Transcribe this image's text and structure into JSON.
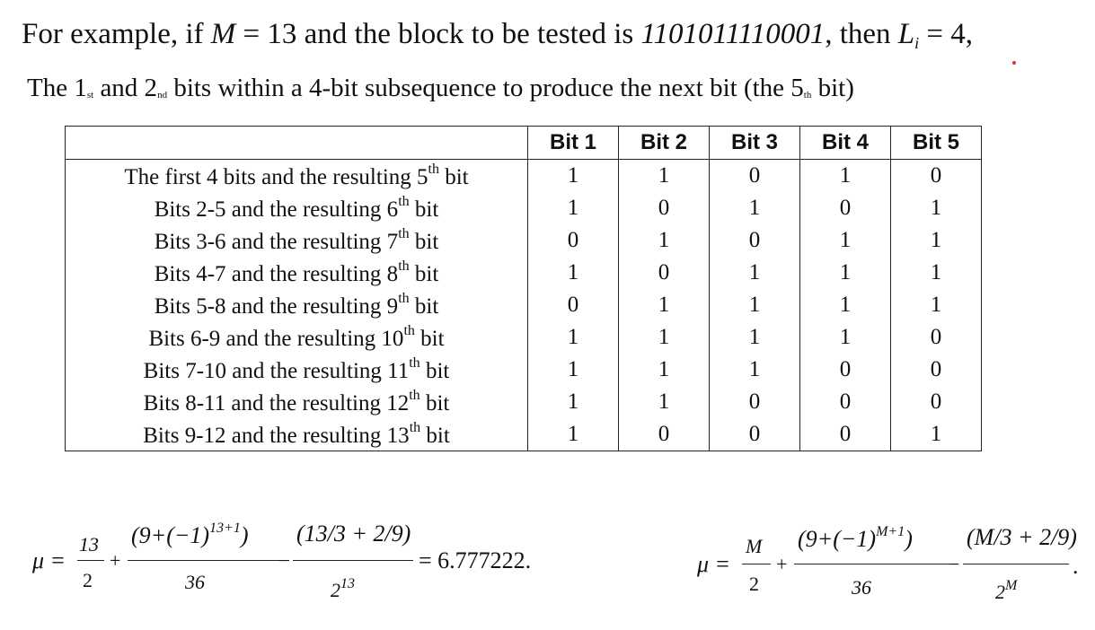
{
  "intro": {
    "prefix": "For example, if ",
    "var_M": "M",
    "eq_M": " = 13",
    "mid": " and the block to be tested is ",
    "block": "1101011110001",
    "then": ", then ",
    "var_L": "L",
    "sub_i": "i",
    "eq_L": " = 4,"
  },
  "line2": {
    "a": "The 1",
    "sup1": "st",
    "b": " and 2",
    "sup2": "nd",
    "c": " bits within a 4-bit subsequence to produce the next bit (the 5",
    "sup3": "th",
    "d": " bit)"
  },
  "table": {
    "headers": [
      "Bit 1",
      "Bit 2",
      "Bit 3",
      "Bit 4",
      "Bit 5"
    ],
    "rows": [
      {
        "label": "The first 4 bits and the resulting 5",
        "sup": "th",
        "tail": " bit",
        "bits": [
          "1",
          "1",
          "0",
          "1",
          "0"
        ]
      },
      {
        "label": "Bits 2-5 and the resulting 6",
        "sup": "th",
        "tail": " bit",
        "bits": [
          "1",
          "0",
          "1",
          "0",
          "1"
        ]
      },
      {
        "label": "Bits 3-6 and the resulting 7",
        "sup": "th",
        "tail": " bit",
        "bits": [
          "0",
          "1",
          "0",
          "1",
          "1"
        ]
      },
      {
        "label": "Bits 4-7 and the resulting 8",
        "sup": "th",
        "tail": " bit",
        "bits": [
          "1",
          "0",
          "1",
          "1",
          "1"
        ]
      },
      {
        "label": "Bits 5-8 and the resulting 9",
        "sup": "th",
        "tail": " bit",
        "bits": [
          "0",
          "1",
          "1",
          "1",
          "1"
        ]
      },
      {
        "label": "Bits 6-9 and the resulting 10",
        "sup": "th",
        "tail": " bit",
        "bits": [
          "1",
          "1",
          "1",
          "1",
          "0"
        ]
      },
      {
        "label": "Bits 7-10 and the resulting 11",
        "sup": "th",
        "tail": " bit",
        "bits": [
          "1",
          "1",
          "1",
          "0",
          "0"
        ]
      },
      {
        "label": "Bits 8-11 and the resulting 12",
        "sup": "th",
        "tail": " bit",
        "bits": [
          "1",
          "1",
          "0",
          "0",
          "0"
        ]
      },
      {
        "label": "Bits 9-12 and the resulting 13",
        "sup": "th",
        "tail": " bit",
        "bits": [
          "1",
          "0",
          "0",
          "0",
          "1"
        ]
      }
    ]
  },
  "formula_left": {
    "mu": "μ =",
    "n1": "13",
    "d1": "2",
    "plus": "+",
    "n2": "(9+(−1)",
    "n2exp": "13+1",
    "n2close": ")",
    "d2": "36",
    "minus": "−",
    "n3": "(13/3 + 2/9)",
    "d3": "2",
    "d3exp": "13",
    "result": "= 6.777222."
  },
  "formula_right": {
    "mu": "μ =",
    "n1": "M",
    "d1": "2",
    "plus": "+",
    "n2": "(9+(−1)",
    "n2exp": "M+1",
    "n2close": ")",
    "d2": "36",
    "minus": "−",
    "n3": "(M/3 + 2/9)",
    "d3": "2",
    "d3exp": "M",
    "end": "."
  }
}
